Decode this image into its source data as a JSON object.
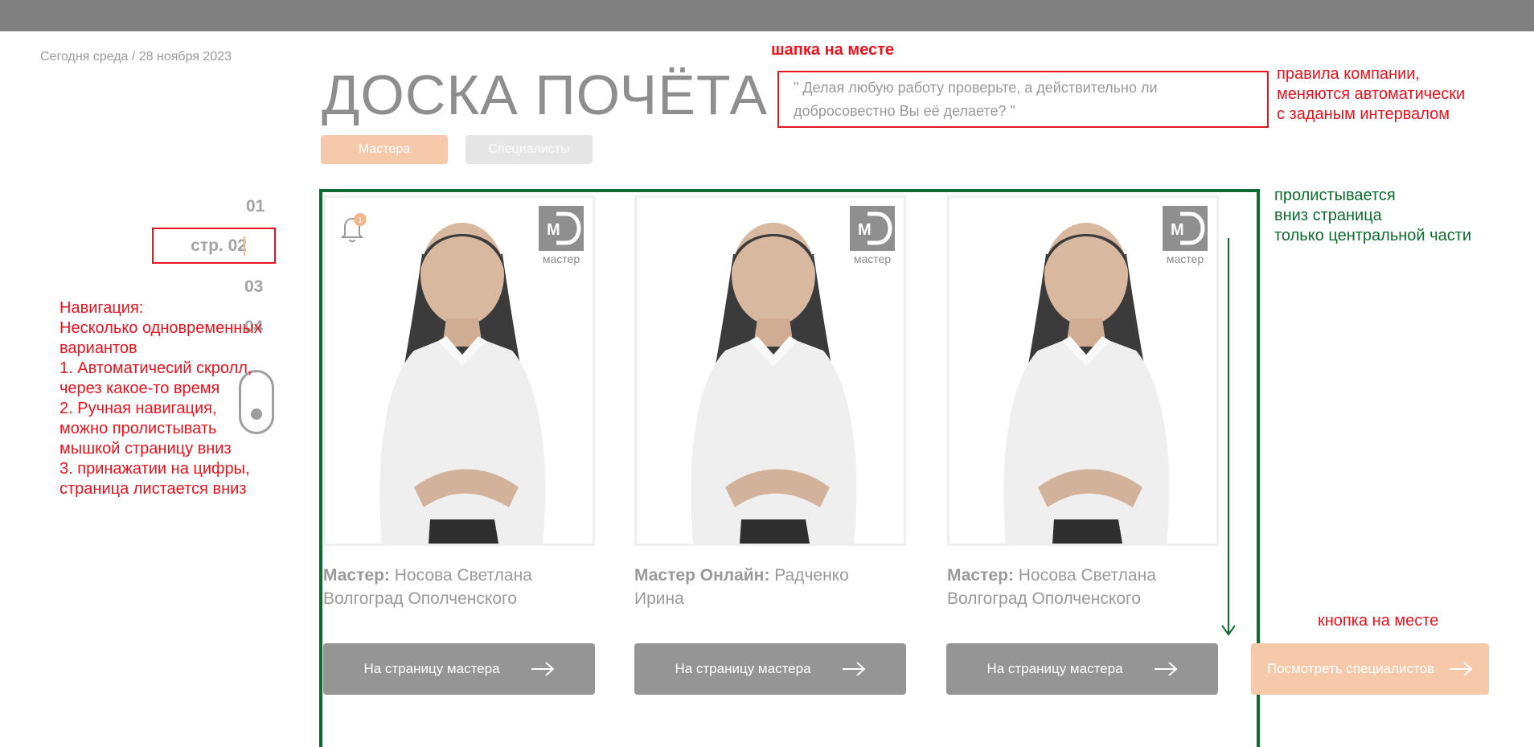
{
  "header": {
    "date": "Сегодня среда / 28 ноября 2023",
    "title": "ДОСКА ПОЧЁТА",
    "quote": "\" Делая любую работу проверьте, а действительно ли добросовестно Вы её делаете? \""
  },
  "tabs": [
    {
      "label": "Мастера",
      "active": true
    },
    {
      "label": "Специалисты",
      "active": false
    }
  ],
  "pagination": {
    "items": [
      "01",
      "стр. 02",
      "03",
      "04"
    ],
    "active_index": 1
  },
  "cards": [
    {
      "role": "Мастер:",
      "name": "Носова Светлана",
      "city": "Волгоград Ополченского",
      "badge": "мастер",
      "button": "На страницу мастера",
      "bell_count": "1"
    },
    {
      "role": "Мастер Онлайн:",
      "name": "Радченко",
      "city": "Ирина",
      "badge": "мастер",
      "button": "На страницу мастера"
    },
    {
      "role": "Мастер:",
      "name": "Носова Светлана",
      "city": "Волгоград Ополченского",
      "badge": "мастер",
      "button": "На страницу мастера"
    }
  ],
  "specialists_button": "Посмотреть специалистов",
  "annotations": {
    "header_note": "шапка на месте",
    "rules_note": "правила компании,\nменяются автоматически\nс заданым интервалом",
    "scroll_note": "пролистывается\nвниз страница\nтолько центральной части",
    "button_note": "кнопка на месте",
    "navigation_note": "Навигация:\nНесколько одновременных\nвариантов\n1. Автоматичесий скролл,\nчерез какое-то время\n2.  Ручная навигация,\nможно пролистывать\nмышкой страницу вниз\n3. принажатии на цифры,\nстраница листается вниз"
  },
  "colors": {
    "annotation_red": "#e8141e",
    "annotation_green": "#0d6b2f",
    "accent_orange": "#f5c9a9",
    "button_gray": "#959595"
  },
  "icons": [
    "bell-icon",
    "md-logo-icon",
    "arrow-right-icon",
    "scroll-mouse-icon",
    "down-arrow-icon"
  ]
}
